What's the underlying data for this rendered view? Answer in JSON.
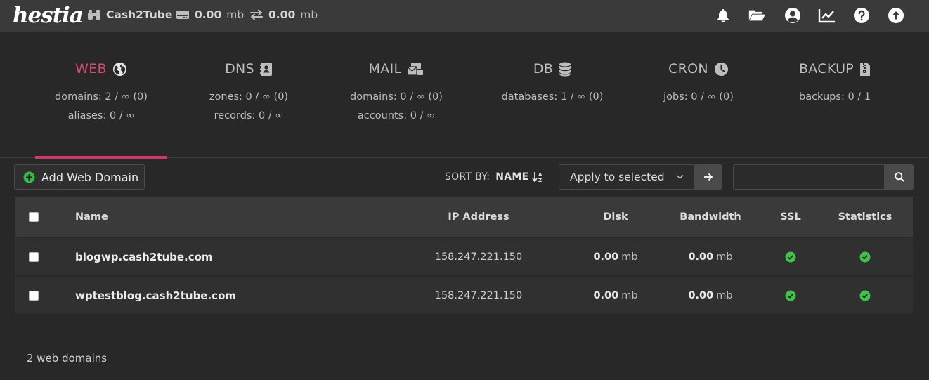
{
  "brand": {
    "logo_text": "hestia"
  },
  "topbar": {
    "user": "Cash2Tube",
    "disk_value": "0.00",
    "disk_unit": "mb",
    "bandwidth_value": "0.00",
    "bandwidth_unit": "mb",
    "icons": [
      "bell-icon",
      "folder-open-icon",
      "user-circle-icon",
      "chart-line-icon",
      "question-circle-icon",
      "arrow-circle-up-icon"
    ]
  },
  "tabs": [
    {
      "title": "WEB",
      "icon": "globe-icon",
      "line1": "domains: 2 / ∞ (0)",
      "line2": "aliases: 0 / ∞",
      "active": true
    },
    {
      "title": "DNS",
      "icon": "address-book-icon",
      "line1": "zones: 0 / ∞ (0)",
      "line2": "records: 0 / ∞",
      "active": false
    },
    {
      "title": "MAIL",
      "icon": "mail-bulk-icon",
      "line1": "domains: 0 / ∞ (0)",
      "line2": "accounts: 0 / ∞",
      "active": false
    },
    {
      "title": "DB",
      "icon": "database-icon",
      "line1": "databases: 1 / ∞ (0)",
      "line2": "",
      "active": false
    },
    {
      "title": "CRON",
      "icon": "clock-icon",
      "line1": "jobs: 0 / ∞ (0)",
      "line2": "",
      "active": false
    },
    {
      "title": "BACKUP",
      "icon": "file-archive-icon",
      "line1": "backups: 0 / 1",
      "line2": "",
      "active": false
    }
  ],
  "toolbar": {
    "add_label": "Add Web Domain",
    "sort_label": "SORT BY:",
    "sort_value": "NAME",
    "apply_label": "Apply to selected",
    "search_value": ""
  },
  "table": {
    "headers": {
      "name": "Name",
      "ip": "IP Address",
      "disk": "Disk",
      "bandwidth": "Bandwidth",
      "ssl": "SSL",
      "statistics": "Statistics"
    },
    "rows": [
      {
        "name": "blogwp.cash2tube.com",
        "ip": "158.247.221.150",
        "disk_value": "0.00",
        "disk_unit": "mb",
        "bw_value": "0.00",
        "bw_unit": "mb"
      },
      {
        "name": "wptestblog.cash2tube.com",
        "ip": "158.247.221.150",
        "disk_value": "0.00",
        "disk_unit": "mb",
        "bw_value": "0.00",
        "bw_unit": "mb"
      }
    ]
  },
  "footer": {
    "count": "2 web domains"
  },
  "colors": {
    "accent": "#d8336a",
    "success": "#3ec44a",
    "add_icon": "#39b54a"
  }
}
